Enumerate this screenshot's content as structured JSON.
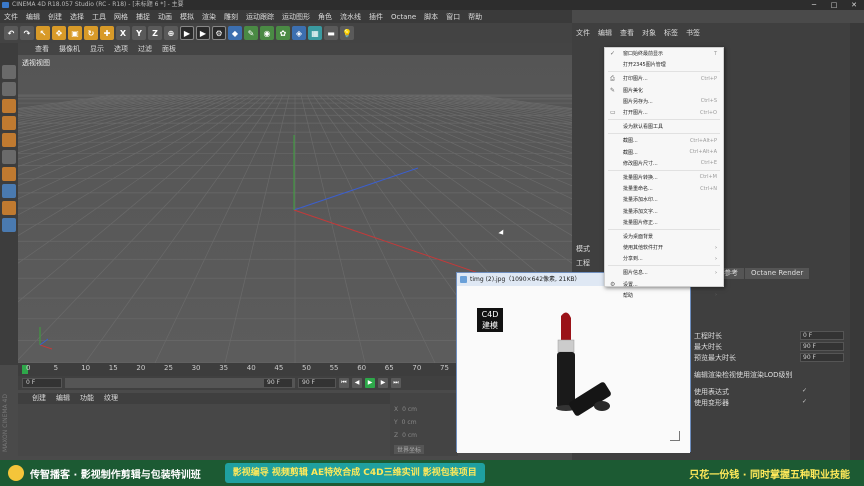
{
  "app": {
    "title": "CINEMA 4D R18.057 Studio (RC - R18) - [未标题 6 *] - 主要"
  },
  "menubar": [
    "文件",
    "编辑",
    "创建",
    "选择",
    "工具",
    "网格",
    "捕捉",
    "动画",
    "模拟",
    "渲染",
    "雕刻",
    "运动跟踪",
    "运动图形",
    "角色",
    "流水线",
    "插件",
    "Octane",
    "脚本",
    "窗口",
    "帮助"
  ],
  "toolbar": {
    "axes": [
      "X",
      "Y",
      "Z"
    ]
  },
  "viewport": {
    "tabs": [
      "查看",
      "摄像机",
      "显示",
      "选项",
      "过滤",
      "面板"
    ],
    "label": "透视视图"
  },
  "timeline": {
    "ticks": [
      "0",
      "5",
      "10",
      "15",
      "20",
      "25",
      "30",
      "35",
      "40",
      "45",
      "50",
      "55",
      "60",
      "65",
      "70",
      "75"
    ],
    "start_field": "0 F",
    "current_field": "0 F",
    "end_field": "90 F",
    "end_field2": "90 F"
  },
  "material": {
    "tabs": [
      "创建",
      "编辑",
      "功能",
      "纹理"
    ]
  },
  "coords": {
    "rows": [
      {
        "axis": "X",
        "value": "0 cm"
      },
      {
        "axis": "Y",
        "value": "0 cm"
      },
      {
        "axis": "Z",
        "value": "0 cm"
      }
    ],
    "mode": "世界坐标"
  },
  "right": {
    "tabs": [
      "文件",
      "编辑",
      "查看",
      "对象",
      "标签",
      "书签"
    ],
    "mode_label": "模式",
    "project_label": "工程",
    "tabs2": [
      "参考",
      "Octane Render"
    ]
  },
  "context_menu": {
    "items": [
      {
        "label": "窗口始终最前显示",
        "shortcut": "T",
        "icon": "check-icon"
      },
      {
        "label": "打开2345图片管理",
        "shortcut": "",
        "icon": ""
      },
      {
        "sep": true
      },
      {
        "label": "打印图片...",
        "shortcut": "Ctrl+P",
        "icon": "printer-icon"
      },
      {
        "label": "图片美化",
        "shortcut": "",
        "icon": "edit-icon"
      },
      {
        "label": "图片另存为...",
        "shortcut": "Ctrl+S",
        "icon": ""
      },
      {
        "label": "打开图片...",
        "shortcut": "Ctrl+O",
        "icon": "folder-icon"
      },
      {
        "sep": true
      },
      {
        "label": "设为默认看图工具",
        "shortcut": "",
        "icon": ""
      },
      {
        "sep": true
      },
      {
        "label": "截图...",
        "shortcut": "Ctrl+Alt+P",
        "icon": ""
      },
      {
        "label": "截图...",
        "shortcut": "Ctrl+Alt+A",
        "icon": ""
      },
      {
        "label": "修改图片尺寸...",
        "shortcut": "Ctrl+E",
        "icon": ""
      },
      {
        "sep": true
      },
      {
        "label": "批量图片转换...",
        "shortcut": "Ctrl+M",
        "icon": ""
      },
      {
        "label": "批量重命名...",
        "shortcut": "Ctrl+N",
        "icon": ""
      },
      {
        "label": "批量添加水印...",
        "shortcut": "",
        "icon": ""
      },
      {
        "label": "批量添加文字...",
        "shortcut": "",
        "icon": ""
      },
      {
        "label": "批量图片修正...",
        "shortcut": "",
        "icon": ""
      },
      {
        "sep": true
      },
      {
        "label": "设为桌面背景",
        "shortcut": "",
        "icon": ""
      },
      {
        "label": "使用其他软件打开",
        "shortcut": "",
        "icon": "",
        "arrow": true
      },
      {
        "label": "分享到...",
        "shortcut": "",
        "icon": "",
        "arrow": true
      },
      {
        "sep": true
      },
      {
        "label": "图片信息...",
        "shortcut": "",
        "icon": "",
        "arrow": true
      },
      {
        "label": "设置...",
        "shortcut": "",
        "icon": "gear-icon"
      },
      {
        "label": "帮助",
        "shortcut": "",
        "icon": "",
        "arrow": true
      }
    ]
  },
  "image_viewer": {
    "title": "timg (2).jpg（1090×642像素, 21KB）",
    "logo_line1": "C4D",
    "logo_line2": "建模"
  },
  "attributes": [
    {
      "label": "工程时长",
      "value": "0 F"
    },
    {
      "label": "最大时长",
      "value": "90 F"
    },
    {
      "label": "预览最大时长",
      "value": "90 F"
    },
    {
      "label": "编辑渲染检视使用渲染LOD级别",
      "value": ""
    },
    {
      "label": "使用表达式",
      "value": "✓"
    },
    {
      "label": "使用变形器",
      "value": "✓"
    }
  ],
  "banner": {
    "left": "传智播客 · 影视制作剪辑与包装特训班",
    "middle": "影视编导  视频剪辑  AE特效合成  C4D三维实训  影视包装项目",
    "right": "只花一份钱 · 同时掌握五种职业技能"
  }
}
